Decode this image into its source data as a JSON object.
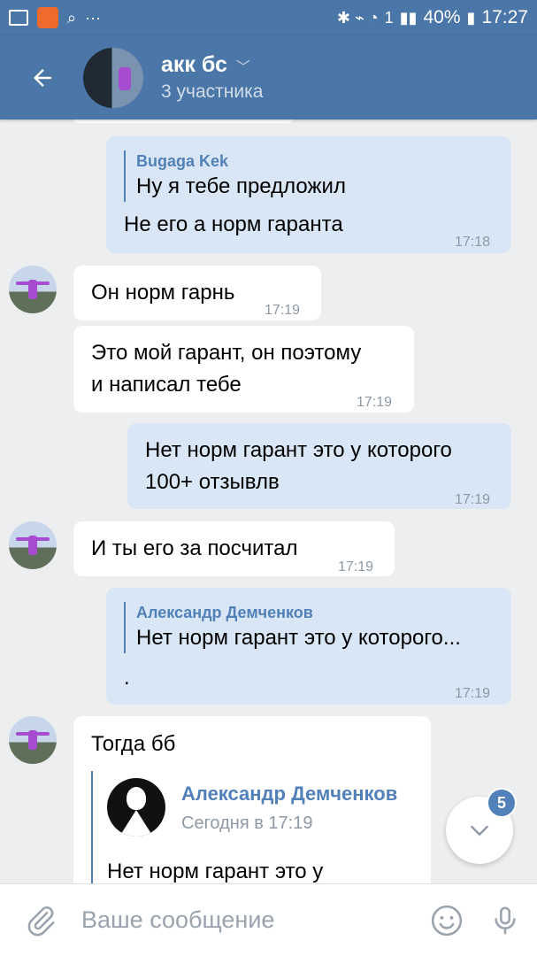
{
  "status_bar": {
    "battery": "40%",
    "time": "17:27",
    "sim": "1",
    "dots": "···"
  },
  "header": {
    "title": "акк бс",
    "subtitle": "3 участника"
  },
  "messages": [
    {
      "quote_name": "Bugaga Kek",
      "quote_text": "Ну я тебе предложил",
      "text": "Не его а норм гаранта",
      "time": "17:18"
    },
    {
      "text": "Он норм гарнь",
      "time": "17:19"
    },
    {
      "text_line1": "Это мой гарант, он поэтому",
      "text_line2": "и написал тебе",
      "time": "17:19"
    },
    {
      "text_line1": "Нет норм гарант это у которого",
      "text_line2": "100+ отзывлв",
      "time": "17:19"
    },
    {
      "text": "И ты его за посчитал",
      "time": "17:19"
    },
    {
      "quote_name": "Александр Демченков",
      "quote_text": "Нет норм гарант это у которого...",
      "text": ".",
      "time": "17:19"
    },
    {
      "text": "Тогда бб",
      "fwd_name": "Александр Демченков",
      "fwd_date": "Сегодня в 17:19",
      "fwd_text": "Нет норм гарант это у"
    }
  ],
  "scroll_badge": "5",
  "input": {
    "placeholder": "Ваше сообщение"
  },
  "icons": [
    "back-arrow-icon",
    "chevron-down-icon",
    "attach-icon",
    "emoji-icon",
    "mic-icon"
  ],
  "colors": {
    "accent": "#4a76a8",
    "outgoing": "#d9e6f5",
    "incoming": "#ffffff",
    "link": "#5181b8"
  }
}
